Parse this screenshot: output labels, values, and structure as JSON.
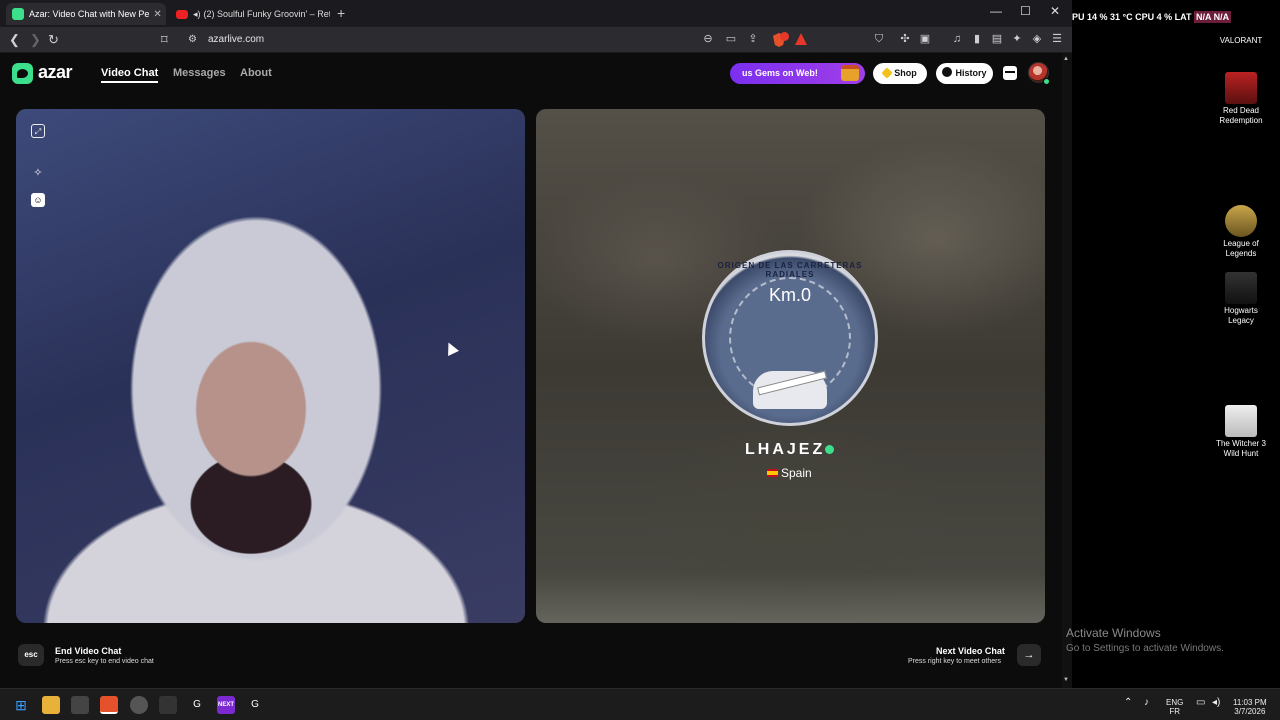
{
  "browser": {
    "tabs": [
      {
        "title": "Azar: Video Chat with New Pe",
        "active": true
      },
      {
        "title": "(2) Soulful Funky Groovin' – Retr",
        "active": false
      }
    ],
    "url": "azarlive.com"
  },
  "site": {
    "logo": "azar",
    "nav": [
      "Video Chat",
      "Messages",
      "About"
    ],
    "gems_label": "us Gems on Web!",
    "shop_label": "Shop",
    "history_label": "History"
  },
  "partner": {
    "seal_text": "ORIGEN DE LAS CARRETERAS RADIALES",
    "seal_km": "Km.0",
    "name": "LHAJEZ",
    "country": "Spain"
  },
  "controls": {
    "esc_key": "esc",
    "end_title": "End Video Chat",
    "end_sub": "Press esc key to end video chat",
    "next_title": "Next Video Chat",
    "next_sub": "Press right key to meet others"
  },
  "overlay": {
    "stats": "PU  14 %  31 °C      CPU  4 %      LAT",
    "lat_value": "N/A  N/A"
  },
  "desktop": {
    "icons": [
      "VALORANT",
      "Red Dead Redemption",
      "League of Legends",
      "Hogwarts Legacy",
      "The Witcher 3 Wild Hunt"
    ],
    "activate_title": "Activate Windows",
    "activate_sub": "Go to Settings to activate Windows."
  },
  "taskbar": {
    "lang": "ENG",
    "lang_sub": "FR",
    "time": "11:03 PM",
    "date": "3/7/2026",
    "next_app": "NEXT"
  },
  "colors": {
    "accent_green": "#3ce08c",
    "gems_purple": "#8a33ee"
  }
}
